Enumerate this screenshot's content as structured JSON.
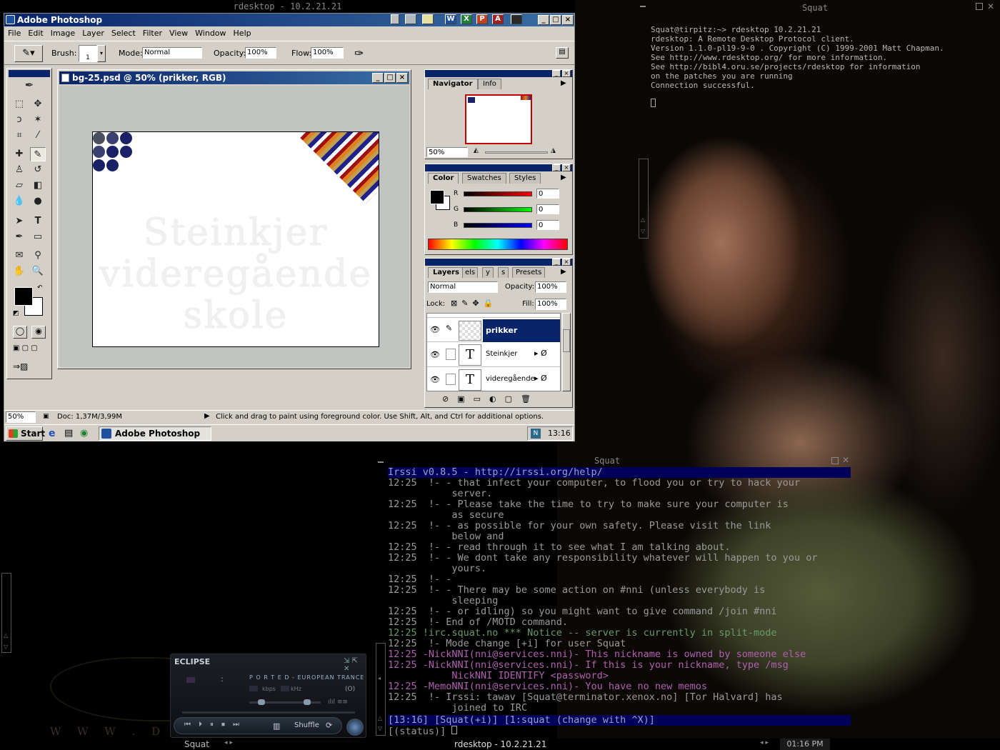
{
  "rdesktop": {
    "title": "rdesktop - 10.2.21.21"
  },
  "photoshop": {
    "title": "Adobe Photoshop",
    "menu": [
      "File",
      "Edit",
      "Image",
      "Layer",
      "Select",
      "Filter",
      "View",
      "Window",
      "Help"
    ],
    "options": {
      "brush_label": "Brush:",
      "brush_size": "1",
      "mode_label": "Mode:",
      "mode_value": "Normal",
      "opacity_label": "Opacity:",
      "opacity_value": "100%",
      "flow_label": "Flow:",
      "flow_value": "100%"
    },
    "document": {
      "title": "bg-25.psd @ 50% (prikker, RGB)",
      "watermark": [
        "Steinkjer",
        "videregående",
        "skole"
      ]
    },
    "navigator": {
      "tabs": [
        "Navigator",
        "Info"
      ],
      "zoom": "50%"
    },
    "color": {
      "tabs": [
        "Color",
        "Swatches",
        "Styles"
      ],
      "channels": [
        {
          "label": "R",
          "value": "0",
          "color": "#c00000"
        },
        {
          "label": "G",
          "value": "0",
          "color": "#00a000"
        },
        {
          "label": "B",
          "value": "0",
          "color": "#0000c0"
        }
      ]
    },
    "layers": {
      "tabs": [
        "Layers",
        "els",
        "y",
        "s",
        "Presets"
      ],
      "blend": "Normal",
      "opacity_label": "Opacity:",
      "opacity": "100%",
      "lock_label": "Lock:",
      "fill_label": "Fill:",
      "fill": "100%",
      "items": [
        {
          "name": "prikker",
          "selected": true
        },
        {
          "name": "Steinkjer",
          "selected": false
        },
        {
          "name": "videregående",
          "selected": false
        }
      ]
    },
    "status": {
      "zoom": "50%",
      "doc": "Doc: 1,37M/3,99M",
      "hint": "Click and drag to paint using foreground color.  Use Shift, Alt, and Ctrl for additional options."
    },
    "taskbar": {
      "start": "Start",
      "app": "Adobe Photoshop",
      "time": "13:16"
    }
  },
  "terminal_top": {
    "title": "Squat",
    "lines": [
      "Squat@tirpitz:~> rdesktop 10.2.21.21",
      "rdesktop: A Remote Desktop Protocol client.",
      "Version 1.1.0-pl19-9-0 . Copyright (C) 1999-2001 Matt Chapman.",
      "See http://www.rdesktop.org/ for more information.",
      "",
      "See http://bibl4.oru.se/projects/rdesktop for information",
      "on the patches you are running",
      "",
      "Connection successful."
    ]
  },
  "irssi": {
    "title": "Squat",
    "header": "Irssi v0.8.5 - http://irssi.org/help/",
    "lines": [
      "12:25  !- - that infect your computer, to flood you or try to hack your",
      "           server.",
      "12:25  !- - Please take the time to try to make sure your computer is",
      "           as secure",
      "12:25  !- - as possible for your own safety. Please visit the link",
      "           below and",
      "12:25  !- - read through it to see what I am talking about.",
      "12:25  !- - We dont take any responsibility whatever will happen to you or",
      "           yours.",
      "12:25  !- -",
      "12:25  !- - There may be some action on #nni (unless everybody is",
      "           sleeping",
      "12:25  !- - or idling) so you might want to give command /join #nni",
      "12:25  !- End of /MOTD command.",
      "12:25 !irc.squat.no *** Notice -- server is currently in split-mode",
      "12:25  !- Mode change [+i] for user Squat",
      "12:25 -NickNNI(nni@services.nni)- This nickname is owned by someone else",
      "12:25 -NickNNI(nni@services.nni)- If this is your nickname, type /msg",
      "           NickNNI IDENTIFY <password>",
      "12:25 -MemoNNI(nni@services.nni)- You have no new memos",
      "12:25  !- Irssi: tawav [Squat@terminator.xenox.no] [Tor Halvard] has",
      "           joined to IRC"
    ],
    "statusbar": "[13:16] [Squat(+i)] [1:squat (change with ^X)]",
    "prompt": "[(status)] "
  },
  "eclipse": {
    "title": "ECLIPSE",
    "ticker": "P O R T E D - EUROPEAN TRANCE",
    "kbps": "kbps",
    "khz": "kHz",
    "shuffle": "Shuffle",
    "mode": "(O)"
  },
  "bottom": {
    "left": "Squat",
    "center": "rdesktop - 10.2.21.21",
    "clock": "01:16 PM",
    "wallpaper_text": "W W W . D E"
  },
  "colors": {
    "ps_title": "#0a246a",
    "ps_face": "#d4d0c8",
    "irssi_bar": "#00005a",
    "dot": "#1a2066"
  }
}
